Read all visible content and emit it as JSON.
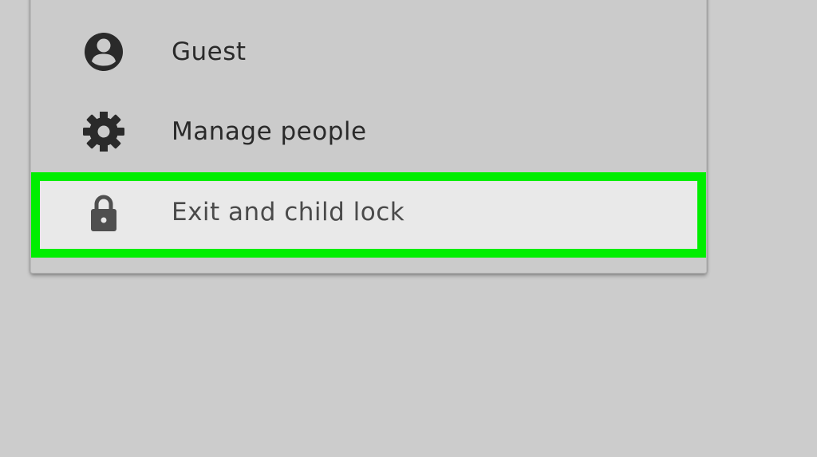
{
  "menu": {
    "items": [
      {
        "label": "Guest",
        "icon": "account-circle-icon"
      },
      {
        "label": "Manage people",
        "icon": "gear-icon"
      },
      {
        "label": "Exit and child lock",
        "icon": "lock-icon",
        "highlighted": true
      }
    ]
  },
  "colors": {
    "background": "#cccccc",
    "menu_background": "#cbcbcb",
    "highlight_border": "#00ee00",
    "highlight_fill": "#e9e9e9",
    "icon": "#2a2a2a",
    "text": "#2a2a2a"
  }
}
